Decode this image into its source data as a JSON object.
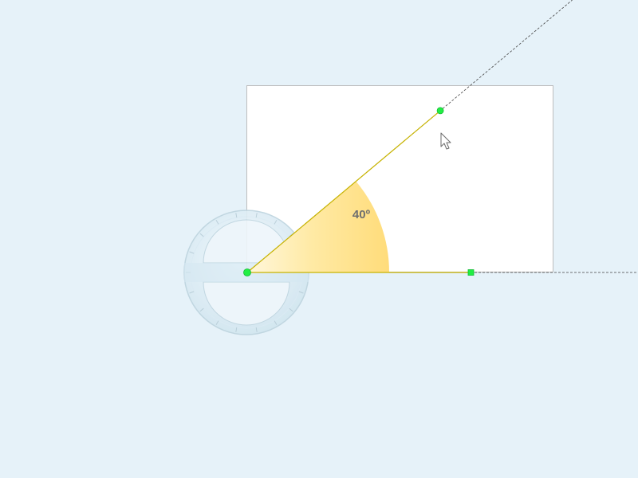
{
  "canvas": {
    "background": "#e6f2f9"
  },
  "angle": {
    "value_degrees": 40,
    "label": "40º",
    "sector_color": "#ffdc7a",
    "arm_color": "#c8b400",
    "guide_color": "#444444"
  },
  "handles": {
    "color": "#22ee44",
    "vertex_shape": "circle",
    "arm_end_shape": "circle",
    "base_end_shape": "square"
  },
  "protractor": {
    "color": "#d3e8f2",
    "icon": "protractor-icon"
  },
  "cursor": {
    "icon": "arrow-cursor-icon"
  }
}
